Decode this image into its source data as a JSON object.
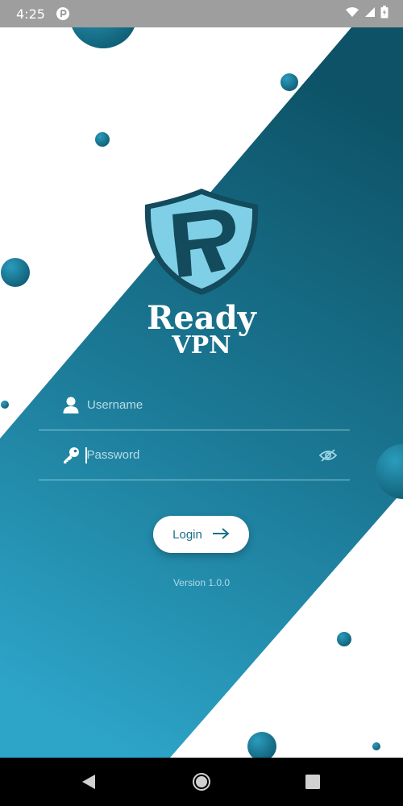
{
  "status_bar": {
    "time": "4:25"
  },
  "brand": {
    "name": "Ready",
    "subname": "VPN"
  },
  "form": {
    "username": {
      "value": "",
      "placeholder": "Username"
    },
    "password": {
      "value": "",
      "placeholder": "Password"
    },
    "login_label": "Login",
    "version": "Version 1.0.0"
  },
  "colors": {
    "primary": "#1a6f86",
    "gradient_top": "#0d5266",
    "gradient_bottom": "#2da5c9",
    "logo_light": "#7fd0e6",
    "logo_dark": "#134a5c"
  },
  "icons": {
    "username": "user-icon",
    "password": "key-icon",
    "toggle": "eye-off-icon",
    "login": "arrow-right-icon"
  }
}
